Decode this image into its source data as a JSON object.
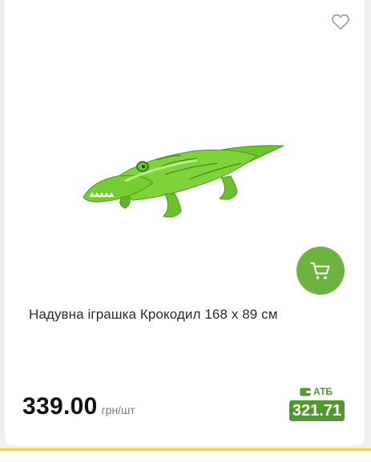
{
  "product": {
    "title": "Надувна іграшка Крокодил 168 х 89 см",
    "price": "339.00",
    "price_unit": "грн/шт",
    "store_label": "АТБ",
    "store_price": "321.71",
    "image_icon": "inflatable-crocodile-image"
  },
  "icons": {
    "favorite": "heart-icon",
    "cart": "cart-icon",
    "store": "wallet-icon"
  },
  "colors": {
    "accent_green": "#6cb33f",
    "atb_green": "#4f9a2c",
    "divider_yellow": "#f2d33d"
  }
}
